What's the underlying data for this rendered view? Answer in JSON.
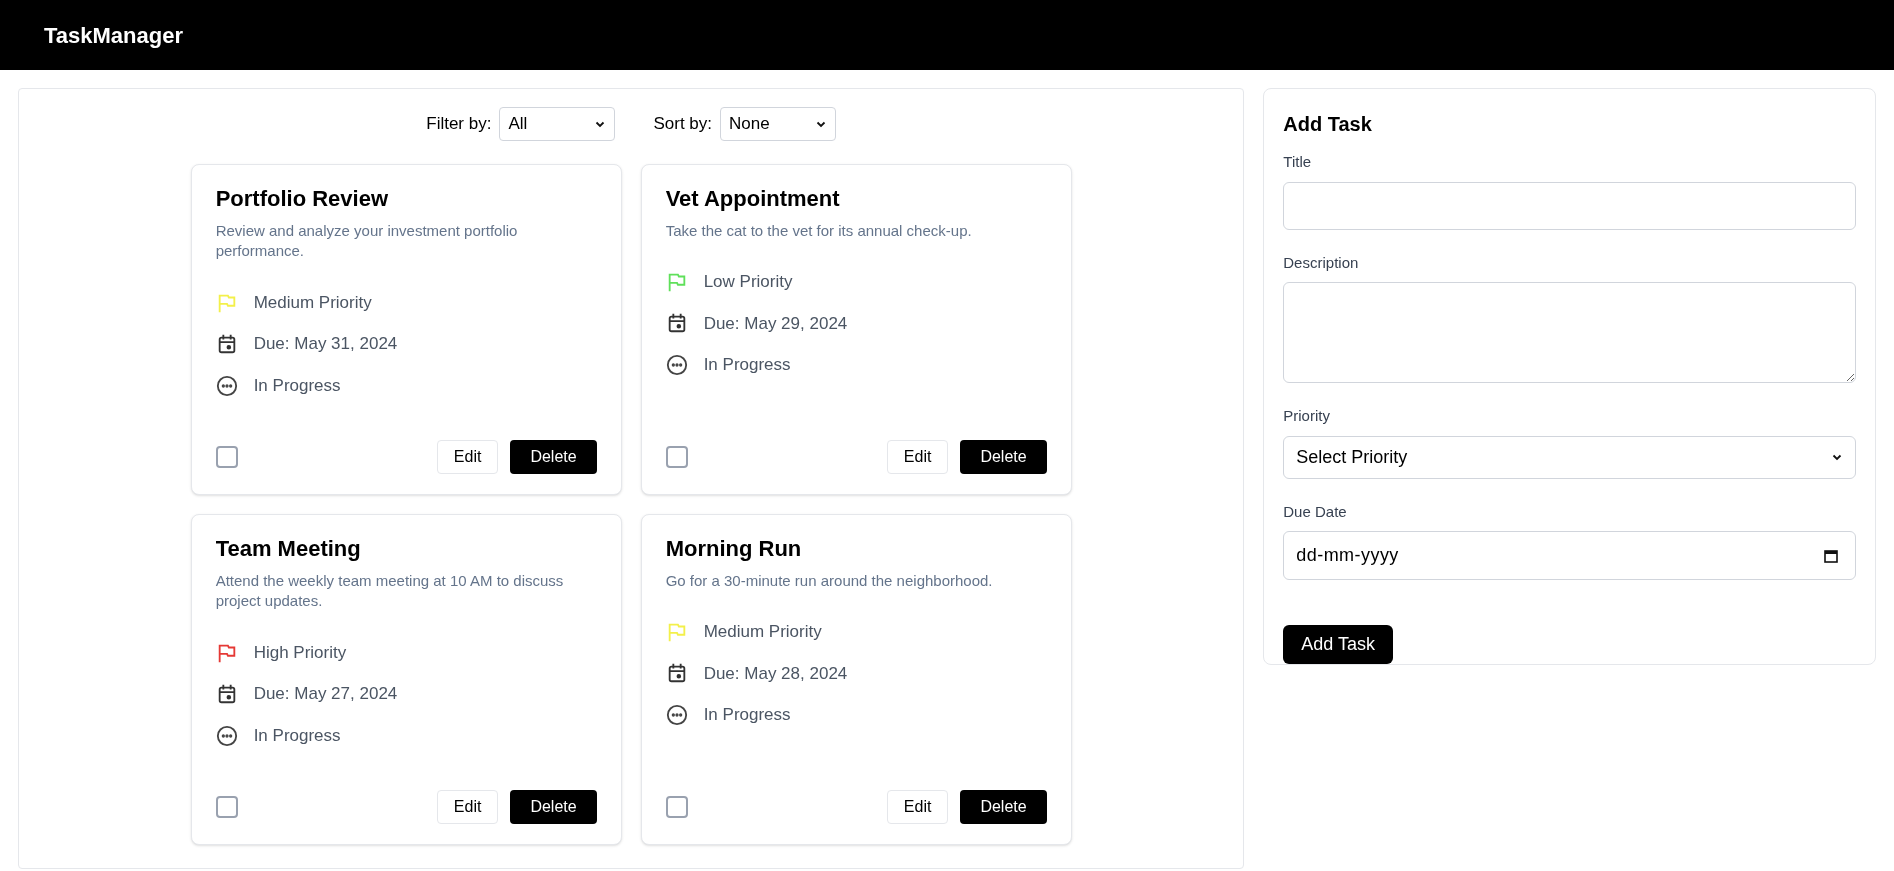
{
  "header": {
    "brand": "TaskManager"
  },
  "filters": [
    {
      "label": "Filter by:",
      "value": "All"
    },
    {
      "label": "Sort by:",
      "value": "None"
    }
  ],
  "tasks": [
    {
      "title": "Portfolio Review",
      "description": "Review and analyze your investment portfolio performance.",
      "priority": "Medium Priority",
      "color": "#f3f04a",
      "due": "Due: May 31, 2024",
      "status": "In Progress",
      "checked": false,
      "actions": [
        "Edit",
        "Delete"
      ]
    },
    {
      "title": "Vet Appointment",
      "description": "Take the cat to the vet for its annual check-up.",
      "priority": "Low Priority",
      "color": "#5fe05a",
      "due": "Due: May 29, 2024",
      "status": "In Progress",
      "checked": false,
      "actions": [
        "Edit",
        "Delete"
      ]
    },
    {
      "title": "Team Meeting",
      "description": "Attend the weekly team meeting at 10 AM to discuss project updates.",
      "priority": "High Priority",
      "color": "#e53935",
      "due": "Due: May 27, 2024",
      "status": "In Progress",
      "checked": false,
      "actions": [
        "Edit",
        "Delete"
      ]
    },
    {
      "title": "Morning Run",
      "description": "Go for a 30-minute run around the neighborhood.",
      "priority": "Medium Priority",
      "color": "#f3f04a",
      "due": "Due: May 28, 2024",
      "status": "In Progress",
      "checked": false,
      "actions": [
        "Edit",
        "Delete"
      ]
    }
  ],
  "form": {
    "title": "Add Task",
    "fields": [
      {
        "kind": "text",
        "label": "Title"
      },
      {
        "kind": "textarea",
        "label": "Description"
      },
      {
        "kind": "select",
        "label": "Priority",
        "value": "Select Priority"
      },
      {
        "kind": "date",
        "label": "Due Date",
        "placeholder": "dd-mm-yyyy"
      }
    ],
    "submit": "Add Task"
  }
}
